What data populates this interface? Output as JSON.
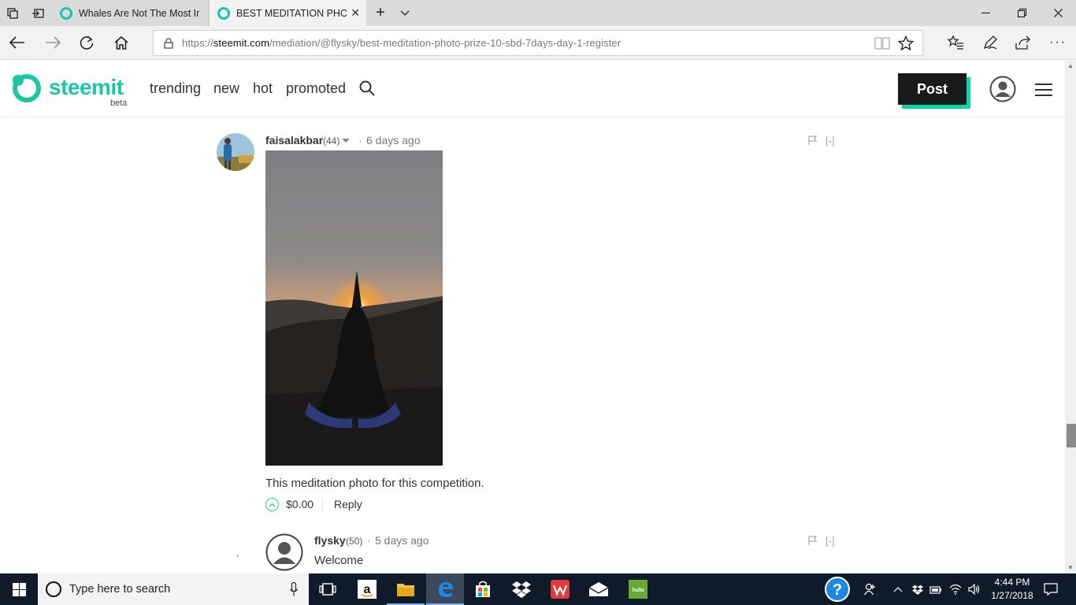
{
  "browser": {
    "tabs": [
      {
        "title": "Whales Are Not The Most Ir",
        "active": false
      },
      {
        "title": "BEST MEDITATION PHO",
        "active": true
      }
    ],
    "url_scheme": "https://",
    "url_domain": "steemit.com",
    "url_path": "/mediation/@flysky/best-meditation-photo-prize-10-sbd-7days-day-1-register"
  },
  "header": {
    "logo_text": "steemit",
    "logo_beta": "beta",
    "nav": [
      "trending",
      "new",
      "hot",
      "promoted"
    ],
    "post_label": "Post",
    "accent": "#1bc7a3"
  },
  "comments": [
    {
      "author": "faisalakbar",
      "reputation": "(44)",
      "time": "6 days ago",
      "body": "This meditation photo for this competition.",
      "payout": "$0.00",
      "reply_label": "Reply",
      "collapse_label": "[-]"
    },
    {
      "author": "flysky",
      "reputation": "(50)",
      "time": "5 days ago",
      "body": "Welcome",
      "collapse_label": "[-]"
    }
  ],
  "taskbar": {
    "search_placeholder": "Type here to search",
    "time": "4:44 PM",
    "date": "1/27/2018",
    "hulu_label": "hulu"
  }
}
